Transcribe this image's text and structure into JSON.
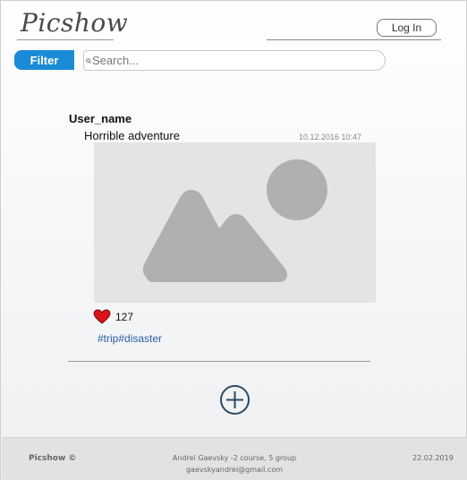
{
  "header": {
    "logo": "Picshow",
    "login_label": "Log In"
  },
  "toolbar": {
    "filter_label": "Filter",
    "search_placeholder": "Search..."
  },
  "post": {
    "user": "User_name",
    "title": "Horrible adventure",
    "date": "10.12.2016 10:47",
    "likes": "127",
    "tags": "#trip#disaster",
    "image_icon": "image-placeholder-icon",
    "like_icon": "heart-icon",
    "like_color": "#d9141b"
  },
  "add_button_icon": "plus-circle-icon",
  "footer": {
    "brand": "Picshow ©",
    "author_line1": "Andrei Gaevsky -2 course, 5 group",
    "author_line2": "gaevskyandrei@gmail.com",
    "date": "22.02.2019"
  },
  "colors": {
    "accent": "#1a8bd6",
    "tag": "#2a5da8",
    "add_button": "#2a4a63"
  }
}
